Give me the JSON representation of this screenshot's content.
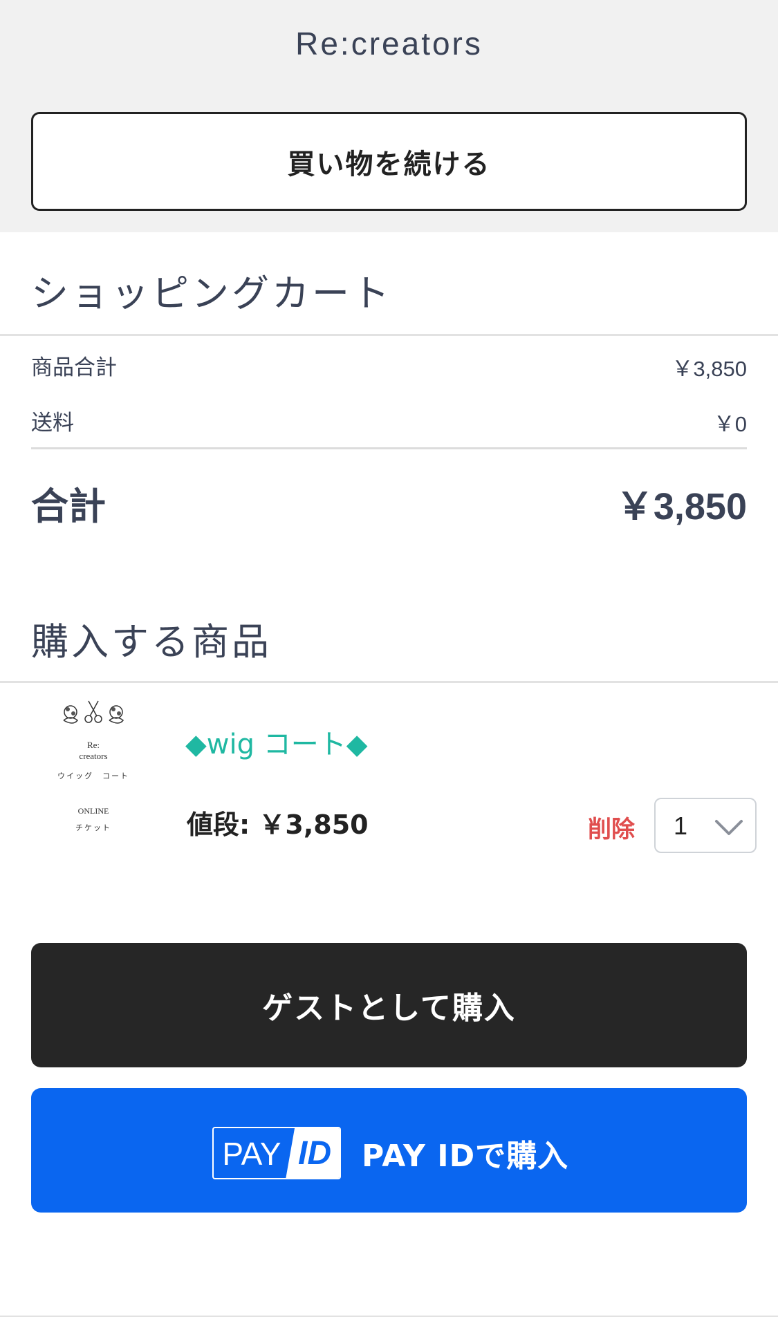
{
  "header": {
    "store_name": "Re:creators",
    "continue_label": "買い物を続ける"
  },
  "cart": {
    "title": "ショッピングカート",
    "subtotal_label": "商品合計",
    "subtotal_value": "￥3,850",
    "shipping_label": "送料",
    "shipping_value": "￥0",
    "total_label": "合計",
    "total_value": "￥3,850"
  },
  "items_section": {
    "title": "購入する商品",
    "items": [
      {
        "thumbnail": {
          "brand_line1": "Re:",
          "brand_line2": "creators",
          "line3": "ウイッグ　コート",
          "line4": "ONLINE",
          "line5": "チケット"
        },
        "name": "◆wig コート◆",
        "price_label": "値段:  ￥3,850",
        "delete_label": "削除",
        "quantity": "1"
      }
    ]
  },
  "actions": {
    "guest_label": "ゲストとして購入",
    "payid_logo_pay": "PAY",
    "payid_logo_id": "ID",
    "payid_label": "PAY IDで購入"
  },
  "colors": {
    "accent_teal": "#1fb8a2",
    "delete_red": "#e04e4e",
    "payid_blue": "#0a66f0",
    "guest_dark": "#262626"
  }
}
